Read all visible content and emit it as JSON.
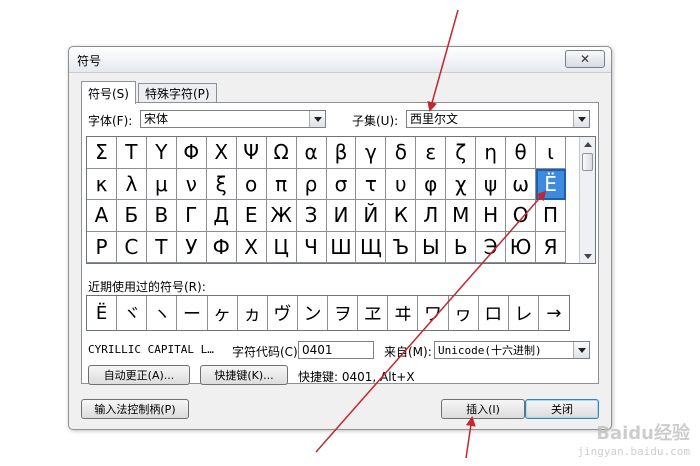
{
  "dialog": {
    "title": "符号",
    "close_symbol": "✕"
  },
  "tabs": [
    {
      "label": "符号(S)"
    },
    {
      "label": "特殊字符(P)"
    }
  ],
  "font": {
    "label": "字体(F):",
    "value": "宋体"
  },
  "subset": {
    "label": "子集(U):",
    "value": "西里尔文"
  },
  "symbols": [
    [
      "Σ",
      "Τ",
      "Υ",
      "Φ",
      "Χ",
      "Ψ",
      "Ω",
      "α",
      "β",
      "γ",
      "δ",
      "ε",
      "ζ",
      "η",
      "θ",
      "ι"
    ],
    [
      "κ",
      "λ",
      "μ",
      "ν",
      "ξ",
      "ο",
      "π",
      "ρ",
      "σ",
      "τ",
      "υ",
      "φ",
      "χ",
      "ψ",
      "ω",
      "Ё"
    ],
    [
      "А",
      "Б",
      "В",
      "Г",
      "Д",
      "Е",
      "Ж",
      "З",
      "И",
      "Й",
      "К",
      "Л",
      "М",
      "Н",
      "О",
      "П"
    ],
    [
      "Р",
      "С",
      "Т",
      "У",
      "Ф",
      "Х",
      "Ц",
      "Ч",
      "Ш",
      "Щ",
      "Ъ",
      "Ы",
      "Ь",
      "Э",
      "Ю",
      "Я"
    ]
  ],
  "selected_symbol": "Ё",
  "recent": {
    "label": "近期使用过的符号(R):",
    "symbols": [
      "Ë",
      "ヾ",
      "ヽ",
      "ー",
      "ヶ",
      "ヵ",
      "ヴ",
      "ン",
      "ヲ",
      "ヱ",
      "ヰ",
      "ワ",
      "ヮ",
      "ロ",
      "レ",
      "→"
    ]
  },
  "char_name": "CYRILLIC CAPITAL L…",
  "char_code": {
    "label": "字符代码(C):",
    "value": "0401"
  },
  "from": {
    "label": "来自(M):",
    "value": "Unicode(十六进制)"
  },
  "buttons": {
    "autocorrect": "自动更正(A)...",
    "shortcut_key": "快捷键(K)...",
    "ime": "输入法控制柄(P)",
    "insert": "插入(I)",
    "close": "关闭"
  },
  "shortcut_info": "快捷键: 0401, Alt+X",
  "watermark": {
    "main": "Baidu经验",
    "sub": "jingyan.baidu.com"
  },
  "colors": {
    "selection": "#3d8bdf",
    "annotation_arrow": "#c0282d"
  }
}
